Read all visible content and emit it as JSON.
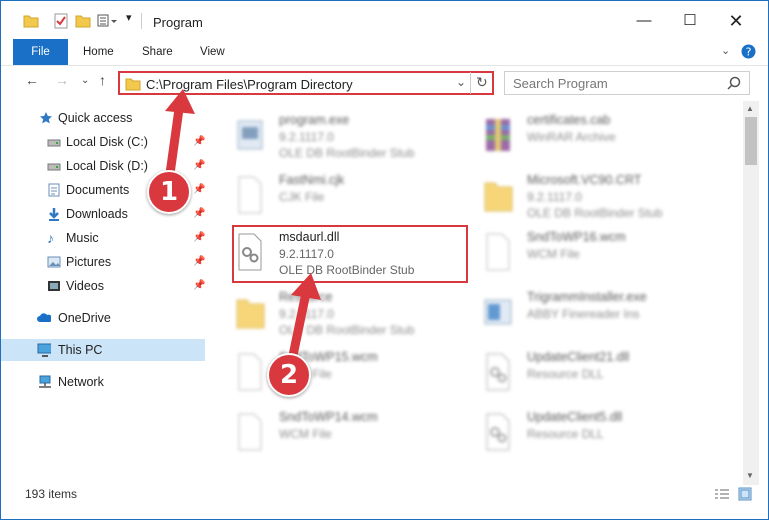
{
  "window": {
    "title": "Program"
  },
  "ribbon": {
    "tabs": [
      "File",
      "Home",
      "Share",
      "View"
    ]
  },
  "address": {
    "path": "C:\\Program Files\\Program Directory"
  },
  "search": {
    "placeholder": "Search Program"
  },
  "nav": {
    "items": [
      {
        "label": "Quick access",
        "icon": "star-icon"
      },
      {
        "label": "Local Disk (C:)",
        "icon": "drive-icon"
      },
      {
        "label": "Local Disk (D:)",
        "icon": "drive-icon"
      },
      {
        "label": "Documents",
        "icon": "documents-icon"
      },
      {
        "label": "Downloads",
        "icon": "download-icon"
      },
      {
        "label": "Music",
        "icon": "music-icon"
      },
      {
        "label": "Pictures",
        "icon": "pictures-icon"
      },
      {
        "label": "Videos",
        "icon": "videos-icon"
      },
      {
        "label": "OneDrive",
        "icon": "cloud-icon"
      },
      {
        "label": "This PC",
        "icon": "computer-icon"
      },
      {
        "label": "Network",
        "icon": "network-icon"
      }
    ]
  },
  "files": [
    {
      "name": "program.exe",
      "line2": "9.2.1117.0",
      "line3": "OLE DB RootBinder Stub"
    },
    {
      "name": "certificates.cab",
      "line2": "WinRAR Archive",
      "line3": ""
    },
    {
      "name": "FastNmi.cjk",
      "line2": "CJK File",
      "line3": ""
    },
    {
      "name": "Microsoft.VC90.CRT",
      "line2": "9.2.1117.0",
      "line3": "OLE DB RootBinder Stub"
    },
    {
      "name": "msdaurl.dll",
      "line2": "9.2.1117.0",
      "line3": "OLE DB RootBinder Stub"
    },
    {
      "name": "SndToWP16.wcm",
      "line2": "WCM File",
      "line3": ""
    },
    {
      "name": "Resource",
      "line2": "9.2.1117.0",
      "line3": "OLE DB RootBinder Stub"
    },
    {
      "name": "TrigrammInstaller.exe",
      "line2": "ABBY Finereader Ins",
      "line3": ""
    },
    {
      "name": "SndToWP15.wcm",
      "line2": "WCM File",
      "line3": ""
    },
    {
      "name": "UpdateClient21.dll",
      "line2": "Resource DLL",
      "line3": ""
    },
    {
      "name": "SndToWP14.wcm",
      "line2": "WCM File",
      "line3": ""
    },
    {
      "name": "UpdateClient5.dll",
      "line2": "Resource DLL",
      "line3": ""
    }
  ],
  "status": {
    "count": "193 items"
  },
  "annotations": {
    "step1": "1",
    "step2": "2"
  },
  "colors": {
    "accent": "#1a6fc6",
    "highlight": "#d9383e"
  }
}
